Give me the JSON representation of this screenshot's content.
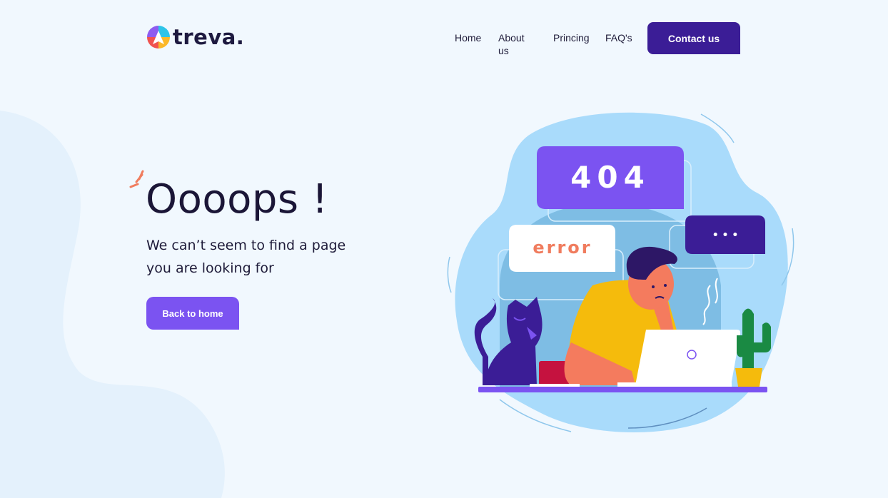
{
  "brand": {
    "name": "treva."
  },
  "nav": {
    "items": [
      "Home",
      "About us",
      "Princing",
      "FAQ's"
    ]
  },
  "header": {
    "contact_label": "Contact us"
  },
  "hero": {
    "headline": "Oooops !",
    "message": "We can’t seem to find a page you are looking for",
    "back_label": "Back to home"
  },
  "illustration": {
    "code_text": "404",
    "error_text": "error",
    "dots_text": "• • •"
  },
  "colors": {
    "background": "#f1f8fe",
    "primary_dark": "#3b1d96",
    "primary": "#7b53f1",
    "error_accent": "#f07c5e"
  }
}
